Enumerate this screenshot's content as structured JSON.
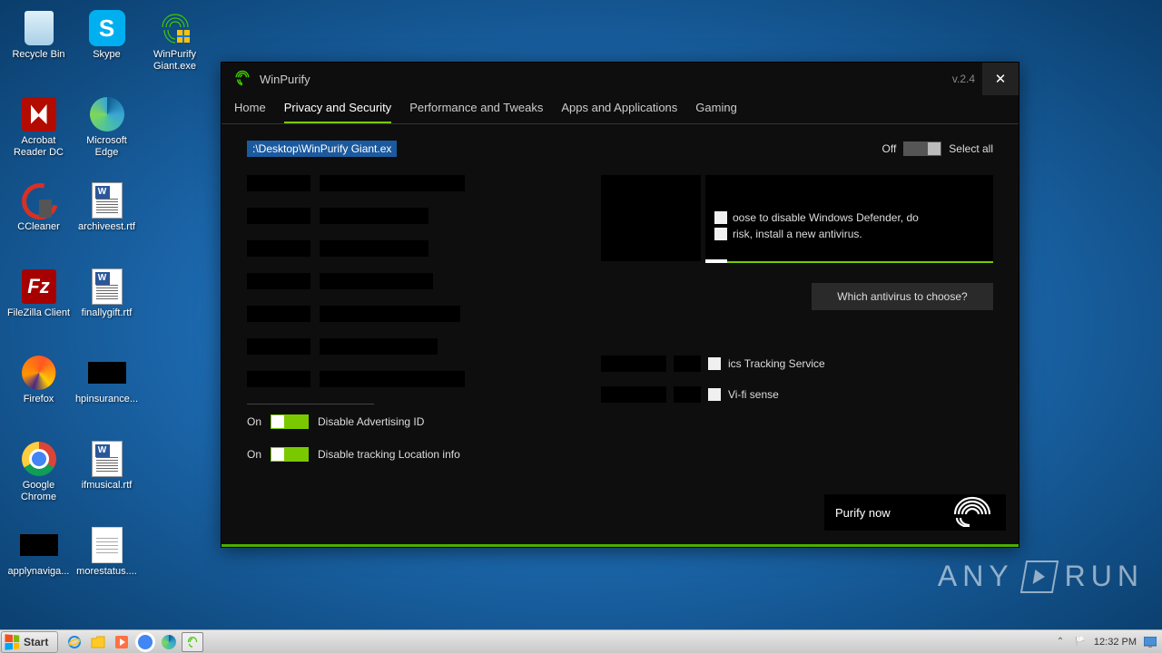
{
  "desktop": {
    "icons": [
      {
        "label": "Recycle Bin",
        "type": "recycle"
      },
      {
        "label": "Skype",
        "type": "skype"
      },
      {
        "label": "WinPurify Giant.exe",
        "type": "winpurify"
      },
      {
        "label": "Acrobat Reader DC",
        "type": "acrobat"
      },
      {
        "label": "Microsoft Edge",
        "type": "edge"
      },
      {
        "label": "",
        "type": "empty"
      },
      {
        "label": "CCleaner",
        "type": "ccleaner"
      },
      {
        "label": "archiveest.rtf",
        "type": "rtf"
      },
      {
        "label": "",
        "type": "empty"
      },
      {
        "label": "FileZilla Client",
        "type": "filezilla"
      },
      {
        "label": "finallygift.rtf",
        "type": "rtf"
      },
      {
        "label": "",
        "type": "empty"
      },
      {
        "label": "Firefox",
        "type": "firefox"
      },
      {
        "label": "hpinsurance...",
        "type": "black"
      },
      {
        "label": "",
        "type": "empty"
      },
      {
        "label": "Google Chrome",
        "type": "chrome"
      },
      {
        "label": "ifmusical.rtf",
        "type": "rtf"
      },
      {
        "label": "",
        "type": "empty"
      },
      {
        "label": "applynaviga...",
        "type": "black"
      },
      {
        "label": "morestatus....",
        "type": "txt"
      }
    ]
  },
  "app": {
    "title": "WinPurify",
    "version": "v.2.4",
    "tabs": [
      "Home",
      "Privacy and Security",
      "Performance and Tweaks",
      "Apps and Applications",
      "Gaming"
    ],
    "active_tab": 1,
    "path_field": ":\\Desktop\\WinPurify Giant.ex",
    "select_all": {
      "label": "Select all",
      "state_label": "Off"
    },
    "info": {
      "line1": "oose to disable Windows Defender, do",
      "line2": "risk, install a new antivirus."
    },
    "antivirus_btn": "Which antivirus to choose?",
    "right_rows": [
      {
        "label": "ics Tracking Service"
      },
      {
        "label": "Vi-fi sense"
      }
    ],
    "left_toggle_rows": [
      {
        "state": "On",
        "label": "Disable Advertising ID"
      },
      {
        "state": "On",
        "label": "Disable tracking Location info"
      }
    ],
    "purify_btn": "Purify now"
  },
  "taskbar": {
    "start": "Start",
    "clock": "12:32 PM"
  },
  "watermark": {
    "brand": "ANY",
    "brand2": "RUN"
  }
}
